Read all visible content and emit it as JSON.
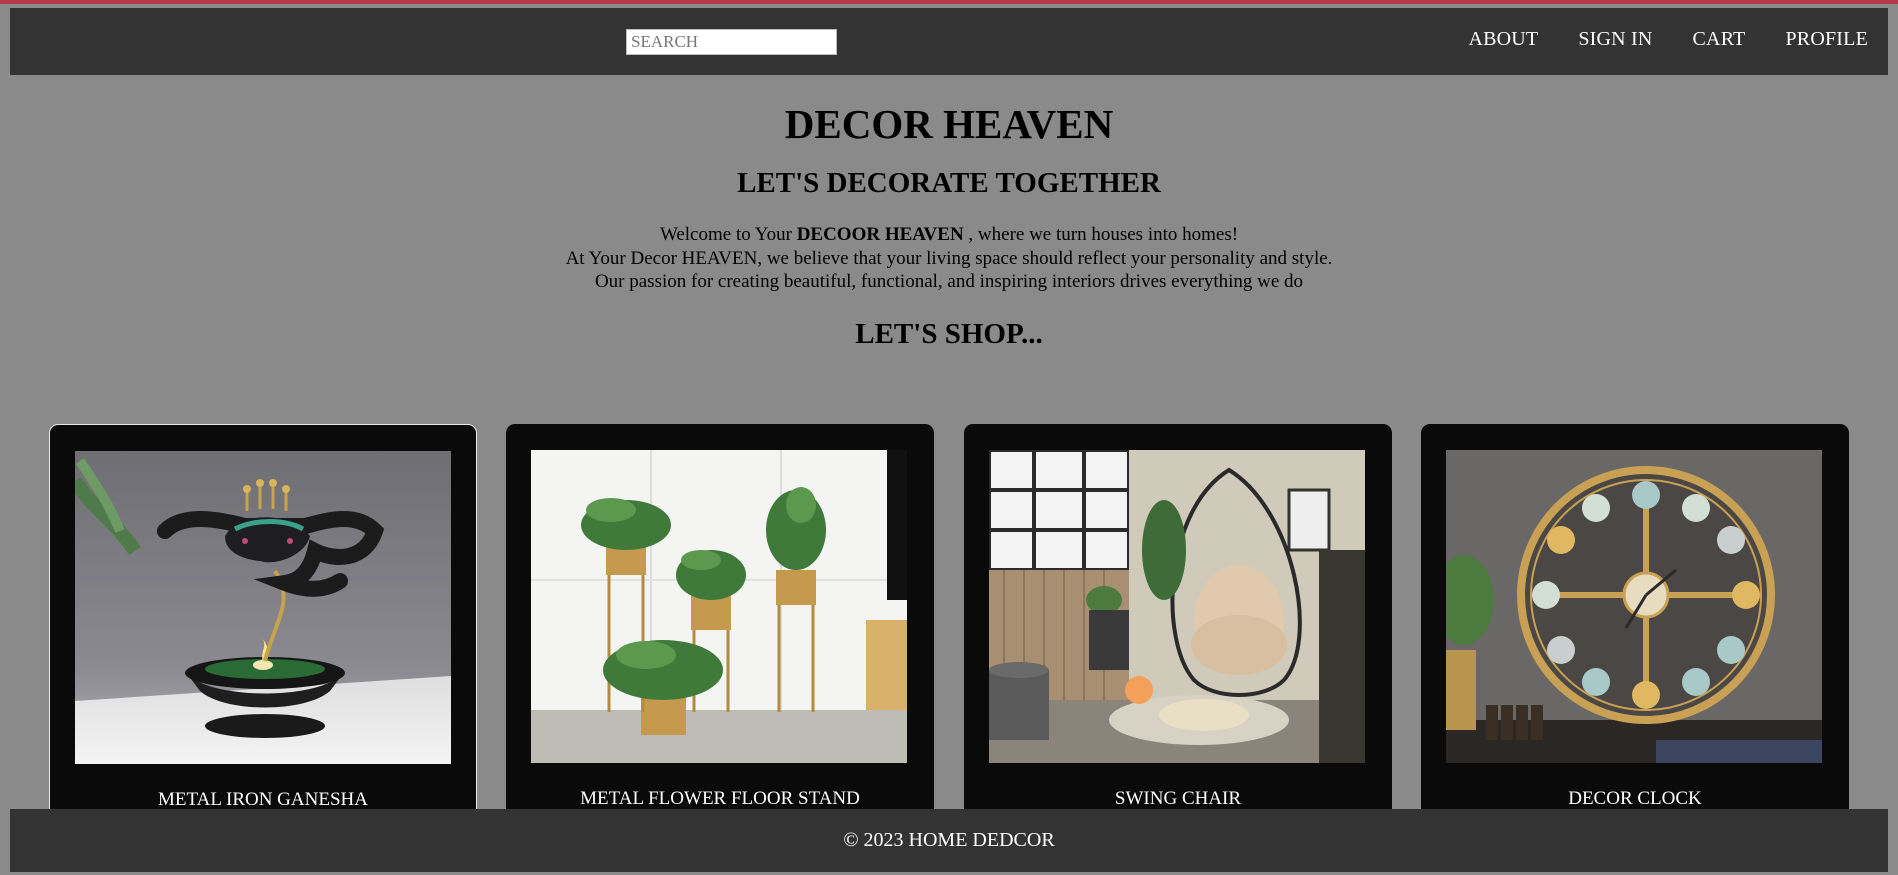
{
  "header": {
    "search_placeholder": "SEARCH",
    "nav": {
      "about": "ABOUT",
      "sign_in": "SIGN IN",
      "cart": "CART",
      "profile": "PROFILE"
    }
  },
  "hero": {
    "title": "DECOR HEAVEN",
    "tagline": "LET'S DECORATE TOGETHER",
    "intro_prefix": "Welcome to Your ",
    "intro_brand": "DECOOR HEAVEN",
    "intro_suffix": " , where we turn houses into homes!",
    "intro_line2": "At Your Decor HEAVEN, we believe that your living space should reflect your personality and style.",
    "intro_line3": "Our passion for creating beautiful, functional, and inspiring interiors drives everything we do",
    "shop_heading": "LET'S SHOP..."
  },
  "products": [
    {
      "name": "METAL IRON GANESHA",
      "image": "ganesha-candle-holder-image"
    },
    {
      "name": "METAL FLOWER FLOOR STAND",
      "image": "flower-floor-stand-image"
    },
    {
      "name": "SWING CHAIR",
      "image": "swing-chair-image"
    },
    {
      "name": "DECOR CLOCK",
      "image": "decor-clock-image"
    }
  ],
  "footer": {
    "text": "© 2023 HOME DEDCOR"
  },
  "colors": {
    "page_bg": "#8a8a8a",
    "bar_bg": "#333333",
    "card_bg": "#0a0a0a",
    "accent_line": "#b33a4a"
  }
}
